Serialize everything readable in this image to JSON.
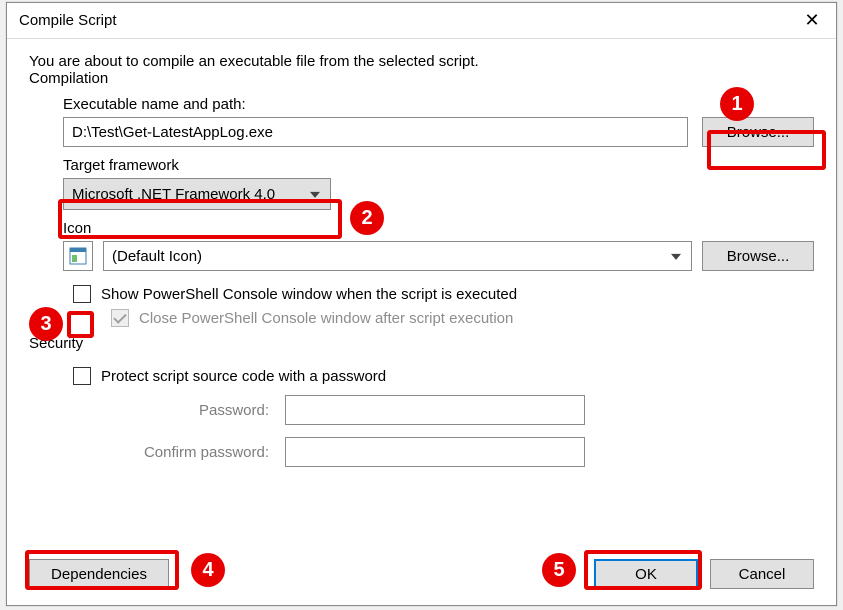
{
  "window": {
    "title": "Compile Script"
  },
  "intro": "You are about to compile an executable file from the selected script.",
  "sections": {
    "compilation": {
      "legend": "Compilation",
      "executable_label": "Executable name and path:",
      "executable_value": "D:\\Test\\Get-LatestAppLog.exe",
      "browse_exe": "Browse...",
      "framework_label": "Target framework",
      "framework_value": "Microsoft .NET Framework 4.0",
      "icon_label": "Icon",
      "icon_value": "(Default Icon)",
      "browse_icon": "Browse...",
      "show_console": "Show PowerShell Console window when the script is executed",
      "close_console": "Close PowerShell Console window after script execution"
    },
    "security": {
      "legend": "Security",
      "protect_label": "Protect script source code with a password",
      "password_label": "Password:",
      "confirm_label": "Confirm password:"
    }
  },
  "buttons": {
    "dependencies": "Dependencies",
    "ok": "OK",
    "cancel": "Cancel"
  },
  "callouts": [
    "1",
    "2",
    "3",
    "4",
    "5"
  ]
}
